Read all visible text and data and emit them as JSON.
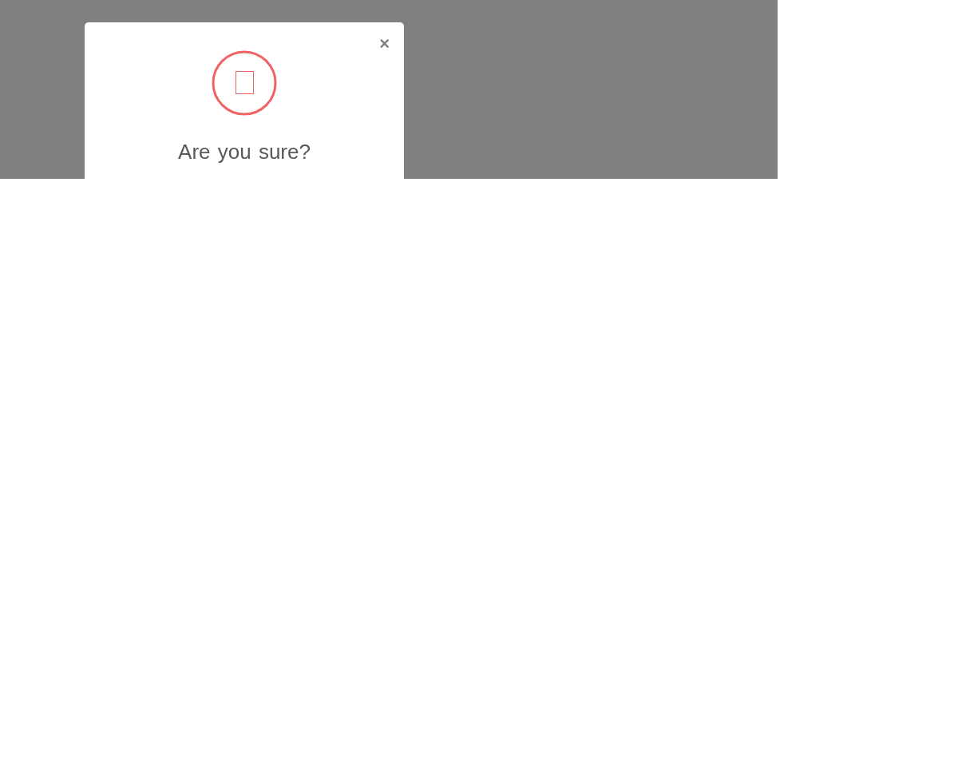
{
  "dialog": {
    "close": "×",
    "title": "Are you sure?"
  }
}
